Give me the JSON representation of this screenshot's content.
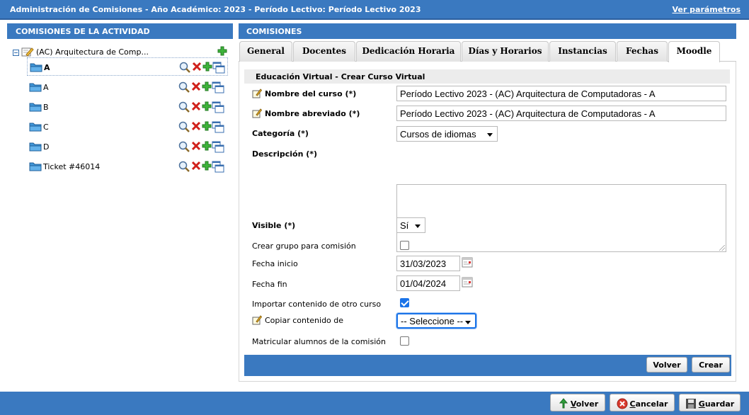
{
  "header": {
    "title": "Administración de Comisiones - Año Académico: 2023 - Período Lectivo: Período Lectivo 2023",
    "link": "Ver parámetros"
  },
  "left_panel": {
    "title": "COMISIONES DE LA ACTIVIDAD",
    "root_label": "(AC) Arquitectura de Comp...",
    "items": [
      {
        "label": "A",
        "selected": true
      },
      {
        "label": "A",
        "selected": false
      },
      {
        "label": "B",
        "selected": false
      },
      {
        "label": "C",
        "selected": false
      },
      {
        "label": "D",
        "selected": false
      },
      {
        "label": "Ticket #46014",
        "selected": false
      }
    ]
  },
  "right_panel": {
    "title": "COMISIONES",
    "tabs": [
      "General",
      "Docentes",
      "Dedicación Horaria",
      "Días y Horarios",
      "Instancias",
      "Fechas",
      "Moodle"
    ],
    "active_tab": "Moodle",
    "section_title": "Educación Virtual - Crear Curso Virtual",
    "form": {
      "nombre_curso_label": "Nombre del curso (*)",
      "nombre_curso_value": "Período Lectivo 2023 - (AC) Arquitectura de Computadoras - A",
      "nombre_abreviado_label": "Nombre abreviado (*)",
      "nombre_abreviado_value": "Período Lectivo 2023 - (AC) Arquitectura de Computadoras - A",
      "categoria_label": "Categoría (*)",
      "categoria_value": "Cursos de idiomas",
      "descripcion_label": "Descripción (*)",
      "descripcion_value": "",
      "visible_label": "Visible (*)",
      "visible_value": "Sí",
      "crear_grupo_label": "Crear grupo para comisión",
      "crear_grupo_checked": false,
      "fecha_inicio_label": "Fecha inicio",
      "fecha_inicio_value": "31/03/2023",
      "fecha_fin_label": "Fecha fin",
      "fecha_fin_value": "01/04/2024",
      "importar_label": "Importar contenido de otro curso",
      "importar_checked": true,
      "copiar_label": "Copiar contenido de",
      "copiar_value": "-- Seleccione --",
      "matricular_label": "Matricular alumnos de la comisión",
      "matricular_checked": false
    },
    "buttons": {
      "volver": "Volver",
      "crear": "Crear"
    }
  },
  "footer": {
    "volver": {
      "pre": "",
      "u": "V",
      "post": "olver"
    },
    "cancelar": {
      "pre": "",
      "u": "C",
      "post": "ancelar"
    },
    "guardar": {
      "pre": "",
      "u": "G",
      "post": "uardar"
    }
  },
  "colors": {
    "accent": "#3a79c0",
    "focus": "#1a73e8"
  }
}
